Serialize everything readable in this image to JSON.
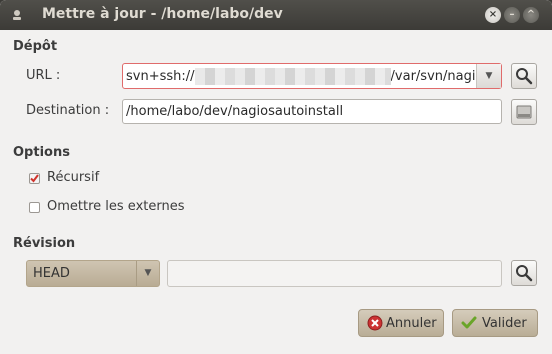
{
  "window": {
    "title": "Mettre à jour - /home/labo/dev",
    "controls": {
      "close": "×",
      "minimize": "–",
      "maximize": "^"
    }
  },
  "depot": {
    "heading": "Dépôt",
    "url_label": "URL :",
    "url_value_prefix": "svn+ssh://",
    "url_value_suffix": "/var/svn/nagio",
    "destination_label": "Destination :",
    "destination_value": "/home/labo/dev/nagiosautoinstall"
  },
  "options": {
    "heading": "Options",
    "recursive_label": "Récursif",
    "recursive_checked": true,
    "externals_label": "Omettre les externes",
    "externals_checked": false
  },
  "revision": {
    "heading": "Révision",
    "selected": "HEAD",
    "value": ""
  },
  "buttons": {
    "cancel_label": "Annuler",
    "ok_label": "Valider"
  },
  "icons": {
    "title": "app-icon",
    "url_browse": "search-icon",
    "destination_browse": "drive-icon",
    "revision_browse": "search-icon",
    "cancel": "cancel-icon",
    "ok": "checkmark-icon"
  },
  "colors": {
    "titlebar": "#3c3b37",
    "background": "#f2f1f0",
    "accent_error": "#e06b6b",
    "check_mark": "#d0342c",
    "ok_icon": "#6aa52a",
    "cancel_icon": "#cc3333"
  }
}
